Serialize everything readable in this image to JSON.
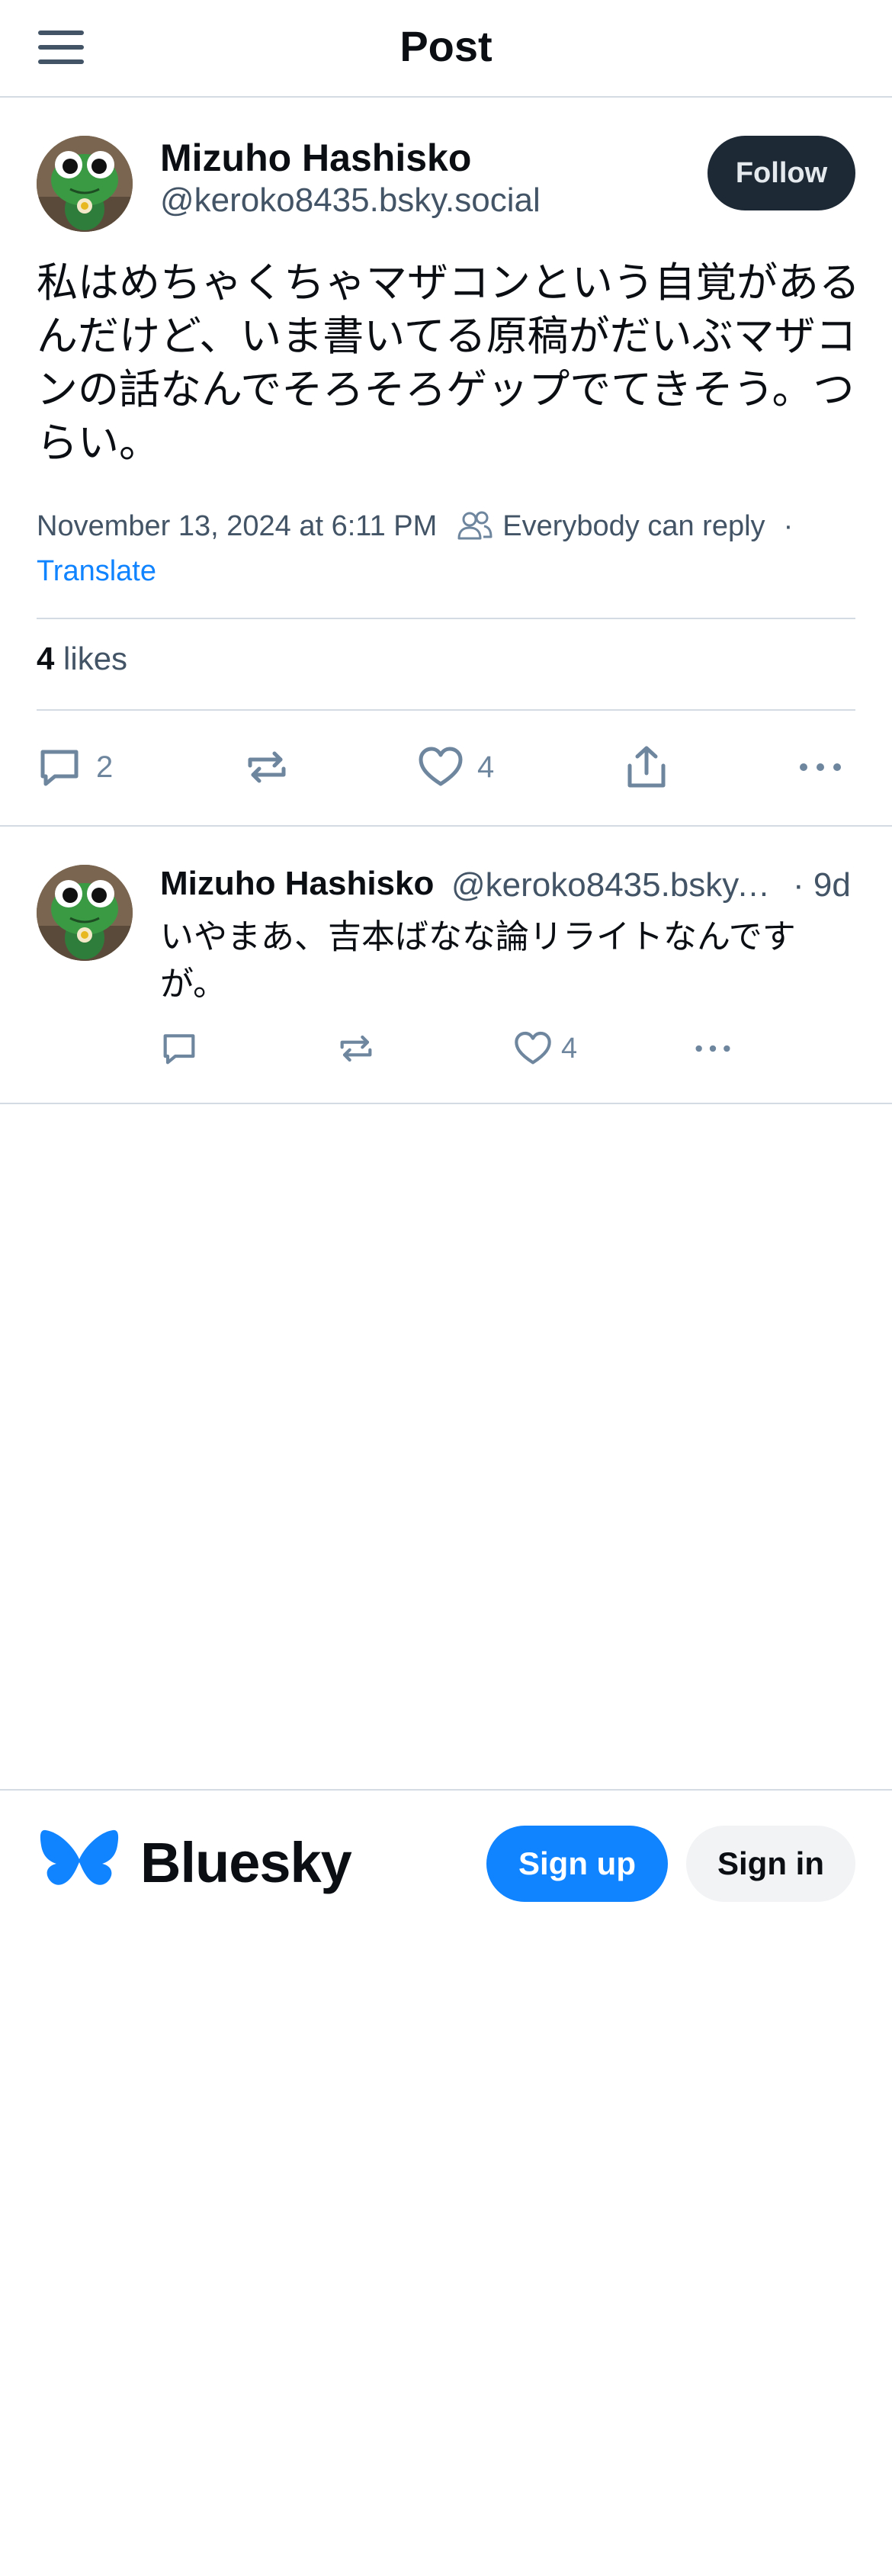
{
  "header": {
    "title": "Post",
    "menu_icon": "hamburger-menu-icon"
  },
  "post": {
    "author_name": "Mizuho Hashisko",
    "author_handle": "@keroko8435.bsky.social",
    "follow_label": "Follow",
    "text": "私はめちゃくちゃマザコンという自覚があるんだけど、いま書いてる原稿がだいぶマザコンの話なんでそろそろゲップでてきそう。つらい。",
    "date": "November 13, 2024 at 6:11 PM",
    "reply_setting": "Everybody can reply",
    "meta_separator": "·",
    "translate_label": "Translate",
    "likes_count": "4",
    "likes_label": "likes",
    "actions": {
      "reply_count": "2",
      "like_count": "4"
    }
  },
  "reply": {
    "author_name": "Mizuho Hashisko",
    "author_handle": "@keroko8435.bsky.social",
    "time": "· 9d",
    "text": "いやまあ、吉本ばなな論リライトなんですが。",
    "actions": {
      "like_count": "4"
    }
  },
  "footer": {
    "brand": "Bluesky",
    "signup_label": "Sign up",
    "signin_label": "Sign in"
  },
  "colors": {
    "accent": "#1083fe",
    "follow_button": "#1e2936",
    "muted_text": "#425466",
    "divider": "#d4dbe2"
  }
}
